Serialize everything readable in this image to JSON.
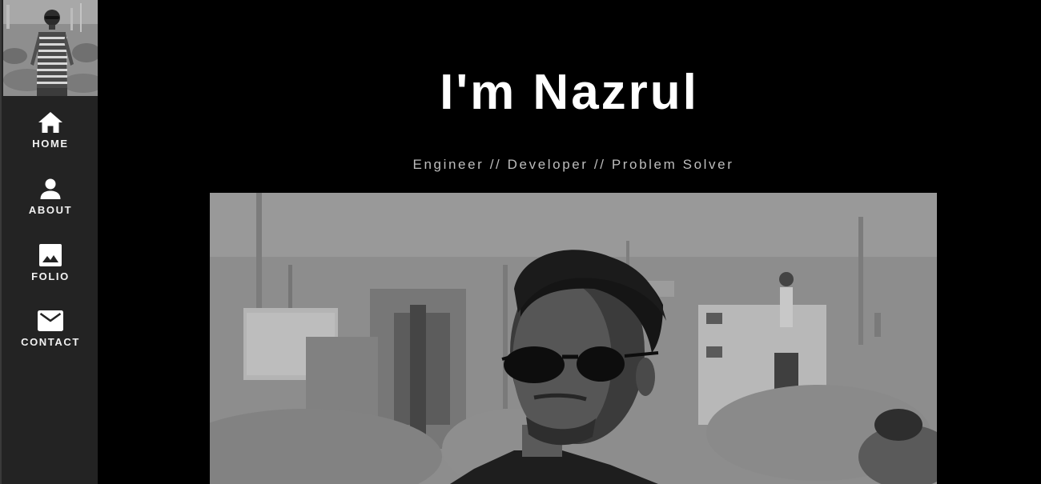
{
  "sidebar": {
    "avatar": {
      "icon": "profile-photo"
    },
    "items": [
      {
        "label": "HOME",
        "icon": "home-icon"
      },
      {
        "label": "ABOUT",
        "icon": "person-icon"
      },
      {
        "label": "FOLIO",
        "icon": "image-icon"
      },
      {
        "label": "CONTACT",
        "icon": "mail-icon"
      }
    ]
  },
  "main": {
    "title": "I'm Nazrul",
    "subtitle": "Engineer // Developer // Problem Solver",
    "hero": {
      "icon": "hero-photo"
    }
  },
  "colors": {
    "background": "#000000",
    "sidebar": "#232323",
    "text": "#ffffff",
    "subtitle": "#bdbdbd"
  }
}
